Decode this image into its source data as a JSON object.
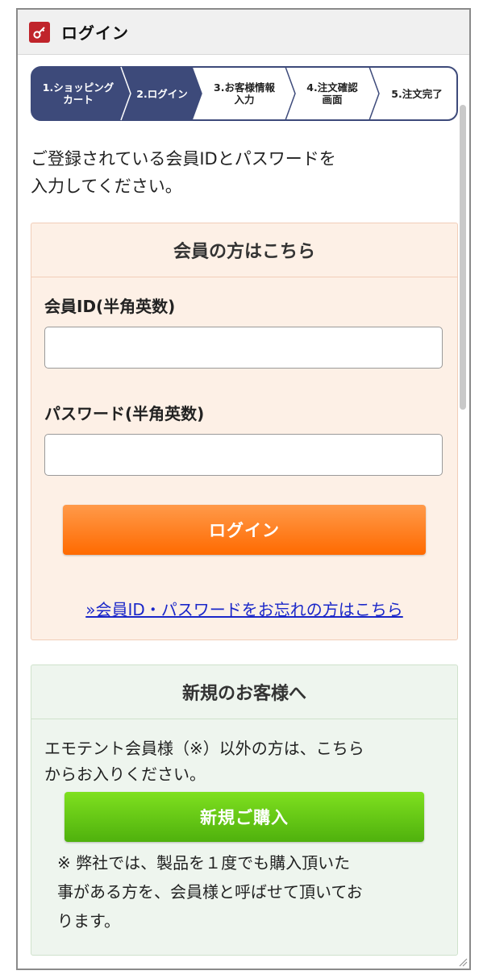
{
  "window": {
    "title": "ログイン",
    "icon": "key-icon"
  },
  "steps": [
    {
      "line1": "1.ショッピング",
      "line2": "カート",
      "state": "done"
    },
    {
      "line1": "2.ログイン",
      "line2": "",
      "state": "current"
    },
    {
      "line1": "3.お客様情報",
      "line2": "入力",
      "state": "todo"
    },
    {
      "line1": "4.注文確認",
      "line2": "画面",
      "state": "todo"
    },
    {
      "line1": "5.注文完了",
      "line2": "",
      "state": "todo"
    }
  ],
  "intro": {
    "line1": "ご登録されている会員IDとパスワードを",
    "line2": "入力してください。"
  },
  "member": {
    "heading": "会員の方はこちら",
    "id_label": "会員ID(半角英数)",
    "id_value": "",
    "password_label": "パスワード(半角英数)",
    "password_value": "",
    "login_label": "ログイン",
    "forgot_link": "»会員ID・パスワードをお忘れの方はこちら"
  },
  "new_customer": {
    "heading": "新規のお客様へ",
    "text_line1": "エモテント会員様（※）以外の方は、こちら",
    "text_line2": "からお入りください。",
    "button_label": "新規ご購入",
    "note_line1": "※ 弊社では、製品を１度でも購入頂いた",
    "note_line2": "事がある方を、会員様と呼ばせて頂いてお",
    "note_line3": "ります。"
  },
  "colors": {
    "step_active": "#3d4a7a",
    "login_button": "#ff7a1a",
    "new_button": "#5cc212",
    "link": "#1a27c9",
    "badge": "#c0242b"
  }
}
